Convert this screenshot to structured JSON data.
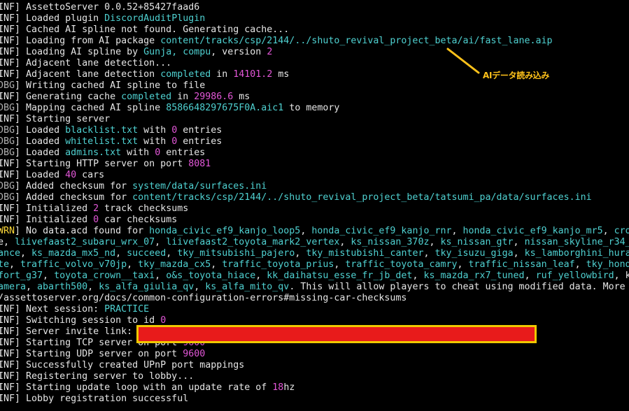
{
  "colors": {
    "background": "#000000",
    "text": "#e6e6e6",
    "cyan": "#4fd1d1",
    "magenta": "#e357d8",
    "warn": "#ffd93a",
    "annotation": "#ffc21a",
    "redaction_fill": "#e81b1b",
    "redaction_border": "#f0c800"
  },
  "annotation": {
    "label": "AIデータ読み込み",
    "icon": "arrow-line"
  },
  "lines": [
    {
      "level": "INF",
      "segments": [
        {
          "t": "AssettoServer 0.0.52+85427faad6",
          "c": "white"
        }
      ]
    },
    {
      "level": "INF",
      "segments": [
        {
          "t": "Loaded plugin ",
          "c": "white"
        },
        {
          "t": "DiscordAuditPlugin",
          "c": "cyan"
        }
      ]
    },
    {
      "level": "INF",
      "segments": [
        {
          "t": "Cached AI spline not found. Generating cache...",
          "c": "white"
        }
      ]
    },
    {
      "level": "INF",
      "segments": [
        {
          "t": "Loading from AI package ",
          "c": "white"
        },
        {
          "t": "content/tracks/csp/2144/../shuto_revival_project_beta/ai/fast_lane.aip",
          "c": "cyan"
        }
      ]
    },
    {
      "level": "INF",
      "segments": [
        {
          "t": "Loading AI spline by ",
          "c": "white"
        },
        {
          "t": "Gunja, compu",
          "c": "cyan"
        },
        {
          "t": ", version ",
          "c": "white"
        },
        {
          "t": "2",
          "c": "mag"
        }
      ]
    },
    {
      "level": "INF",
      "segments": [
        {
          "t": "Adjacent lane detection...",
          "c": "white"
        }
      ]
    },
    {
      "level": "INF",
      "segments": [
        {
          "t": "Adjacent lane detection ",
          "c": "white"
        },
        {
          "t": "completed",
          "c": "cyan"
        },
        {
          "t": " in ",
          "c": "white"
        },
        {
          "t": "14101.2",
          "c": "mag"
        },
        {
          "t": " ms",
          "c": "white"
        }
      ]
    },
    {
      "level": "DBG",
      "segments": [
        {
          "t": "Writing cached AI spline to file",
          "c": "white"
        }
      ]
    },
    {
      "level": "INF",
      "segments": [
        {
          "t": "Generating cache ",
          "c": "white"
        },
        {
          "t": "completed",
          "c": "cyan"
        },
        {
          "t": " in ",
          "c": "white"
        },
        {
          "t": "29986.6",
          "c": "mag"
        },
        {
          "t": " ms",
          "c": "white"
        }
      ]
    },
    {
      "level": "DBG",
      "segments": [
        {
          "t": "Mapping cached AI spline ",
          "c": "white"
        },
        {
          "t": "8586648297675F0A.aic1",
          "c": "cyan"
        },
        {
          "t": " to memory",
          "c": "white"
        }
      ]
    },
    {
      "level": "INF",
      "segments": [
        {
          "t": "Starting server",
          "c": "white"
        }
      ]
    },
    {
      "level": "DBG",
      "segments": [
        {
          "t": "Loaded ",
          "c": "white"
        },
        {
          "t": "blacklist.txt",
          "c": "cyan"
        },
        {
          "t": " with ",
          "c": "white"
        },
        {
          "t": "0",
          "c": "mag"
        },
        {
          "t": " entries",
          "c": "white"
        }
      ]
    },
    {
      "level": "DBG",
      "segments": [
        {
          "t": "Loaded ",
          "c": "white"
        },
        {
          "t": "whitelist.txt",
          "c": "cyan"
        },
        {
          "t": " with ",
          "c": "white"
        },
        {
          "t": "0",
          "c": "mag"
        },
        {
          "t": " entries",
          "c": "white"
        }
      ]
    },
    {
      "level": "DBG",
      "segments": [
        {
          "t": "Loaded ",
          "c": "white"
        },
        {
          "t": "admins.txt",
          "c": "cyan"
        },
        {
          "t": " with ",
          "c": "white"
        },
        {
          "t": "0",
          "c": "mag"
        },
        {
          "t": " entries",
          "c": "white"
        }
      ]
    },
    {
      "level": "INF",
      "segments": [
        {
          "t": "Starting HTTP server on port ",
          "c": "white"
        },
        {
          "t": "8081",
          "c": "mag"
        }
      ]
    },
    {
      "level": "INF",
      "segments": [
        {
          "t": "Loaded ",
          "c": "white"
        },
        {
          "t": "40",
          "c": "mag"
        },
        {
          "t": " cars",
          "c": "white"
        }
      ]
    },
    {
      "level": "DBG",
      "segments": [
        {
          "t": "Added checksum for ",
          "c": "white"
        },
        {
          "t": "system/data/surfaces.ini",
          "c": "cyan"
        }
      ]
    },
    {
      "level": "DBG",
      "segments": [
        {
          "t": "Added checksum for ",
          "c": "white"
        },
        {
          "t": "content/tracks/csp/2144/../shuto_revival_project_beta/tatsumi_pa/data/surfaces.ini",
          "c": "cyan"
        }
      ]
    },
    {
      "level": "INF",
      "segments": [
        {
          "t": "Initialized ",
          "c": "white"
        },
        {
          "t": "2",
          "c": "mag"
        },
        {
          "t": " track checksums",
          "c": "white"
        }
      ]
    },
    {
      "level": "INF",
      "segments": [
        {
          "t": "Initialized ",
          "c": "white"
        },
        {
          "t": "0",
          "c": "mag"
        },
        {
          "t": " car checksums",
          "c": "white"
        }
      ]
    },
    {
      "level": "WRN",
      "segments": [
        {
          "t": "No data.acd found for ",
          "c": "white"
        },
        {
          "t": "honda_civic_ef9_kanjo_loop5",
          "c": "cyan"
        },
        {
          "t": ", ",
          "c": "white"
        },
        {
          "t": "honda_civic_ef9_kanjo_rnr",
          "c": "cyan"
        },
        {
          "t": ", ",
          "c": "white"
        },
        {
          "t": "honda_civic_ef9_kanjo_mr5",
          "c": "cyan"
        },
        {
          "t": ", ",
          "c": "white"
        },
        {
          "t": "cro",
          "c": "cyan"
        }
      ]
    },
    {
      "level": "",
      "segments": [
        {
          "t": "e, ",
          "c": "white"
        },
        {
          "t": "liivefaast2_subaru_wrx_07",
          "c": "cyan"
        },
        {
          "t": ", ",
          "c": "white"
        },
        {
          "t": "liivefaast2_toyota_mark2_vertex",
          "c": "cyan"
        },
        {
          "t": ", ",
          "c": "white"
        },
        {
          "t": "ks_nissan_370z",
          "c": "cyan"
        },
        {
          "t": ", ",
          "c": "white"
        },
        {
          "t": "ks_nissan_gtr",
          "c": "cyan"
        },
        {
          "t": ", ",
          "c": "white"
        },
        {
          "t": "nissan_skyline_r34_",
          "c": "cyan"
        }
      ]
    },
    {
      "level": "",
      "segments": [
        {
          "t": "ance",
          "c": "cyan"
        },
        {
          "t": ", ",
          "c": "white"
        },
        {
          "t": "ks_mazda_mx5_nd",
          "c": "cyan"
        },
        {
          "t": ", ",
          "c": "white"
        },
        {
          "t": "succeed",
          "c": "cyan"
        },
        {
          "t": ", ",
          "c": "white"
        },
        {
          "t": "tky_mitsubishi_pajero",
          "c": "cyan"
        },
        {
          "t": ", ",
          "c": "white"
        },
        {
          "t": "tky_mistubishi_canter",
          "c": "cyan"
        },
        {
          "t": ", ",
          "c": "white"
        },
        {
          "t": "tky_isuzu_giga",
          "c": "cyan"
        },
        {
          "t": ", ",
          "c": "white"
        },
        {
          "t": "ks_lamborghini_hura",
          "c": "cyan"
        }
      ]
    },
    {
      "level": "",
      "segments": [
        {
          "t": "te",
          "c": "cyan"
        },
        {
          "t": ", ",
          "c": "white"
        },
        {
          "t": "traffic_volvo_v70jp",
          "c": "cyan"
        },
        {
          "t": ", ",
          "c": "white"
        },
        {
          "t": "tky_mazda_cx5",
          "c": "cyan"
        },
        {
          "t": ", ",
          "c": "white"
        },
        {
          "t": "traffic_toyota_prius",
          "c": "cyan"
        },
        {
          "t": ", ",
          "c": "white"
        },
        {
          "t": "traffic_toyota_camry",
          "c": "cyan"
        },
        {
          "t": ", ",
          "c": "white"
        },
        {
          "t": "traffic_nissan_leaf",
          "c": "cyan"
        },
        {
          "t": ", ",
          "c": "white"
        },
        {
          "t": "tky_hond",
          "c": "cyan"
        }
      ]
    },
    {
      "level": "",
      "segments": [
        {
          "t": "fort_g37",
          "c": "cyan"
        },
        {
          "t": ", ",
          "c": "white"
        },
        {
          "t": "toyota_crown__taxi",
          "c": "cyan"
        },
        {
          "t": ", ",
          "c": "white"
        },
        {
          "t": "o&s_toyota_hiace",
          "c": "cyan"
        },
        {
          "t": ", ",
          "c": "white"
        },
        {
          "t": "kk_daihatsu_esse_fr_jb_det",
          "c": "cyan"
        },
        {
          "t": ", ",
          "c": "white"
        },
        {
          "t": "ks_mazda_rx7_tuned",
          "c": "cyan"
        },
        {
          "t": ", ",
          "c": "white"
        },
        {
          "t": "ruf_yellowbird",
          "c": "cyan"
        },
        {
          "t": ", k",
          "c": "white"
        }
      ]
    },
    {
      "level": "",
      "segments": [
        {
          "t": "amera",
          "c": "cyan"
        },
        {
          "t": ", ",
          "c": "white"
        },
        {
          "t": "abarth500",
          "c": "cyan"
        },
        {
          "t": ", ",
          "c": "white"
        },
        {
          "t": "ks_alfa_giulia_qv",
          "c": "cyan"
        },
        {
          "t": ", ",
          "c": "white"
        },
        {
          "t": "ks_alfa_mito_qv",
          "c": "cyan"
        },
        {
          "t": ". This will allow players to cheat using modified data. More",
          "c": "white"
        }
      ]
    },
    {
      "level": "",
      "segments": [
        {
          "t": "/assettoserver.org/docs/common-configuration-errors#missing-car-checksums",
          "c": "white"
        }
      ]
    },
    {
      "level": "INF",
      "segments": [
        {
          "t": "Next session: ",
          "c": "white"
        },
        {
          "t": "PRACTICE",
          "c": "cyan"
        }
      ]
    },
    {
      "level": "INF",
      "segments": [
        {
          "t": "Switching session to id ",
          "c": "white"
        },
        {
          "t": "0",
          "c": "mag"
        }
      ]
    },
    {
      "level": "INF",
      "segments": [
        {
          "t": "Server invite link:",
          "c": "white"
        }
      ]
    },
    {
      "level": "INF",
      "segments": [
        {
          "t": "Starting TCP server on port ",
          "c": "white"
        },
        {
          "t": "9600",
          "c": "mag"
        }
      ]
    },
    {
      "level": "INF",
      "segments": [
        {
          "t": "Starting UDP server on port ",
          "c": "white"
        },
        {
          "t": "9600",
          "c": "mag"
        }
      ]
    },
    {
      "level": "INF",
      "segments": [
        {
          "t": "Successfully created UPnP port mappings",
          "c": "white"
        }
      ]
    },
    {
      "level": "INF",
      "segments": [
        {
          "t": "Registering server to lobby...",
          "c": "white"
        }
      ]
    },
    {
      "level": "INF",
      "segments": [
        {
          "t": "Starting update loop with an update rate of ",
          "c": "white"
        },
        {
          "t": "18",
          "c": "mag"
        },
        {
          "t": "hz",
          "c": "white"
        }
      ]
    },
    {
      "level": "INF",
      "segments": [
        {
          "t": "Lobby registration successful",
          "c": "white"
        }
      ]
    }
  ]
}
